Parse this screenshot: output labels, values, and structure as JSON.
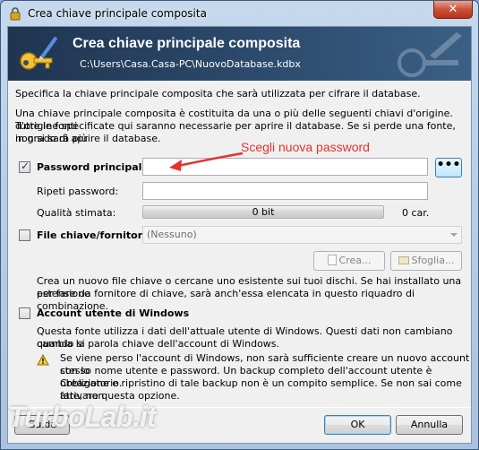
{
  "window": {
    "title": "Crea chiave principale composita",
    "close_label": "✕"
  },
  "banner": {
    "title": "Crea chiave principale composita",
    "path": "C:\\Users\\Casa.Casa-PC\\NuovoDatabase.kdbx"
  },
  "intro": {
    "line1": "Specifica la chiave principale composita che sarà utilizzata per cifrare il database.",
    "line2": "Una chiave principale composita è costituita da una o più delle seguenti chiavi d'origine. Tutte le fonti",
    "line3": "d'origine specificate qui saranno necessarie per aprire il database. Se si perde una fonte, non si sarà più",
    "line4": "in grado di aprire il database."
  },
  "password": {
    "checkbox_label": "Password principale:",
    "checked": true,
    "value": "",
    "repeat_label": "Ripeti password:",
    "repeat_value": "",
    "quality_label": "Qualità stimata:",
    "quality_text": "0 bit",
    "quality_fraction": 0,
    "chars_text": "0 car.",
    "reveal_label": "•••"
  },
  "annotation": {
    "text": "Scegli nuova password",
    "color": "#e5322d"
  },
  "keyfile": {
    "checkbox_label": "File chiave/fornitore:",
    "checked": false,
    "selected": "(Nessuno)",
    "create_label": "Crea...",
    "browse_label": "Sfoglia...",
    "desc1": "Crea un nuovo file chiave o cercane uno esistente sui tuoi dischi. Se hai installato una estensione",
    "desc2": "per fare da fornitore di chiave, sarà anch'essa elencata in questo riquadro di combinazione."
  },
  "windows_account": {
    "checkbox_label": "Account utente di Windows",
    "checked": false,
    "desc1": "Questa fonte utilizza i dati dell'attuale utente di Windows. Questi dati non cambiano quando si",
    "desc2": "cambia la parola chiave dell'account di Windows.",
    "warn1": "Se viene perso l'account di Windows, non sarà sufficiente creare un nuovo account con lo",
    "warn2": "stesso nome utente e password. Un backup completo dell'account utente è obbligatorio.",
    "warn3": "Creazione e ripristino di tale backup non è un compito semplice. Se non sai come fare, non",
    "warn4": "attivare questa opzione."
  },
  "footer": {
    "help_label": "Guida",
    "ok_label": "OK",
    "cancel_label": "Annulla"
  },
  "watermark": {
    "text": "TurboLab.it"
  },
  "colors": {
    "banner": "#2e4d6f",
    "accent": "#3c7fb1",
    "progress_green": "#06b025"
  }
}
